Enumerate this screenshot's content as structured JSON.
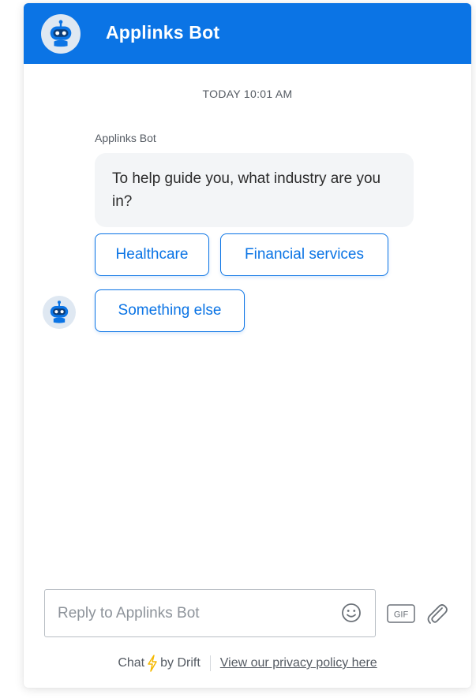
{
  "header": {
    "title": "Applinks Bot",
    "avatar_icon": "robot-icon",
    "background_color": "#0b74e5"
  },
  "conversation": {
    "timestamp": "TODAY 10:01 AM",
    "sender_name": "Applinks Bot",
    "message": "To help guide you, what industry are you in?",
    "options": [
      {
        "label": "Healthcare"
      },
      {
        "label": "Financial services"
      },
      {
        "label": "Something else"
      }
    ]
  },
  "composer": {
    "placeholder": "Reply to Applinks Bot",
    "gif_label": "GIF",
    "icons": [
      "emoji-icon",
      "gif-icon",
      "paperclip-icon"
    ]
  },
  "footer": {
    "chat_label": "Chat",
    "by_label": "by Drift",
    "privacy_link": "View our privacy policy here",
    "bolt_color": "#f5b800"
  },
  "colors": {
    "accent": "#0b74e5",
    "bubble_background": "#f3f5f7"
  }
}
